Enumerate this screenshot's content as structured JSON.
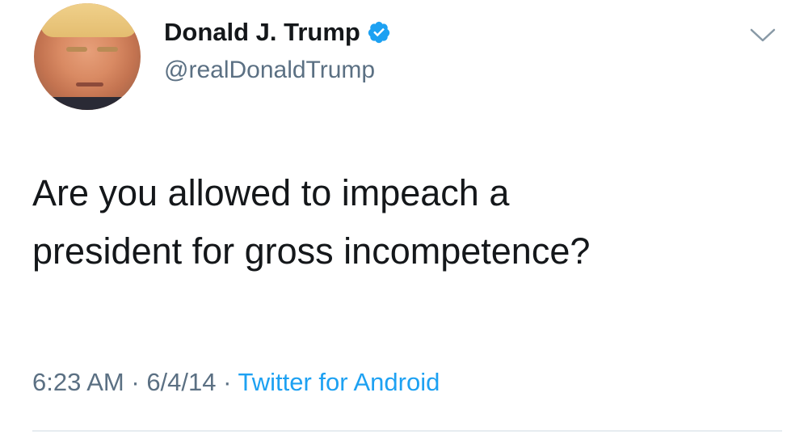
{
  "tweet": {
    "author": {
      "name": "Donald J. Trump",
      "handle": "@realDonaldTrump",
      "verified": true,
      "avatar_icon": "profile-photo"
    },
    "text_lines": [
      "Are you allowed to impeach a",
      "president for gross incompetence?"
    ],
    "meta": {
      "time": "6:23 AM",
      "separator": " · ",
      "date": "6/4/14",
      "source": "Twitter for Android"
    }
  },
  "colors": {
    "text": "#14171a",
    "secondary": "#5b7083",
    "accent": "#1da1f2",
    "divider": "#e6ecf0"
  },
  "icons": {
    "verified": "verified-badge-icon",
    "menu": "chevron-down-icon"
  }
}
